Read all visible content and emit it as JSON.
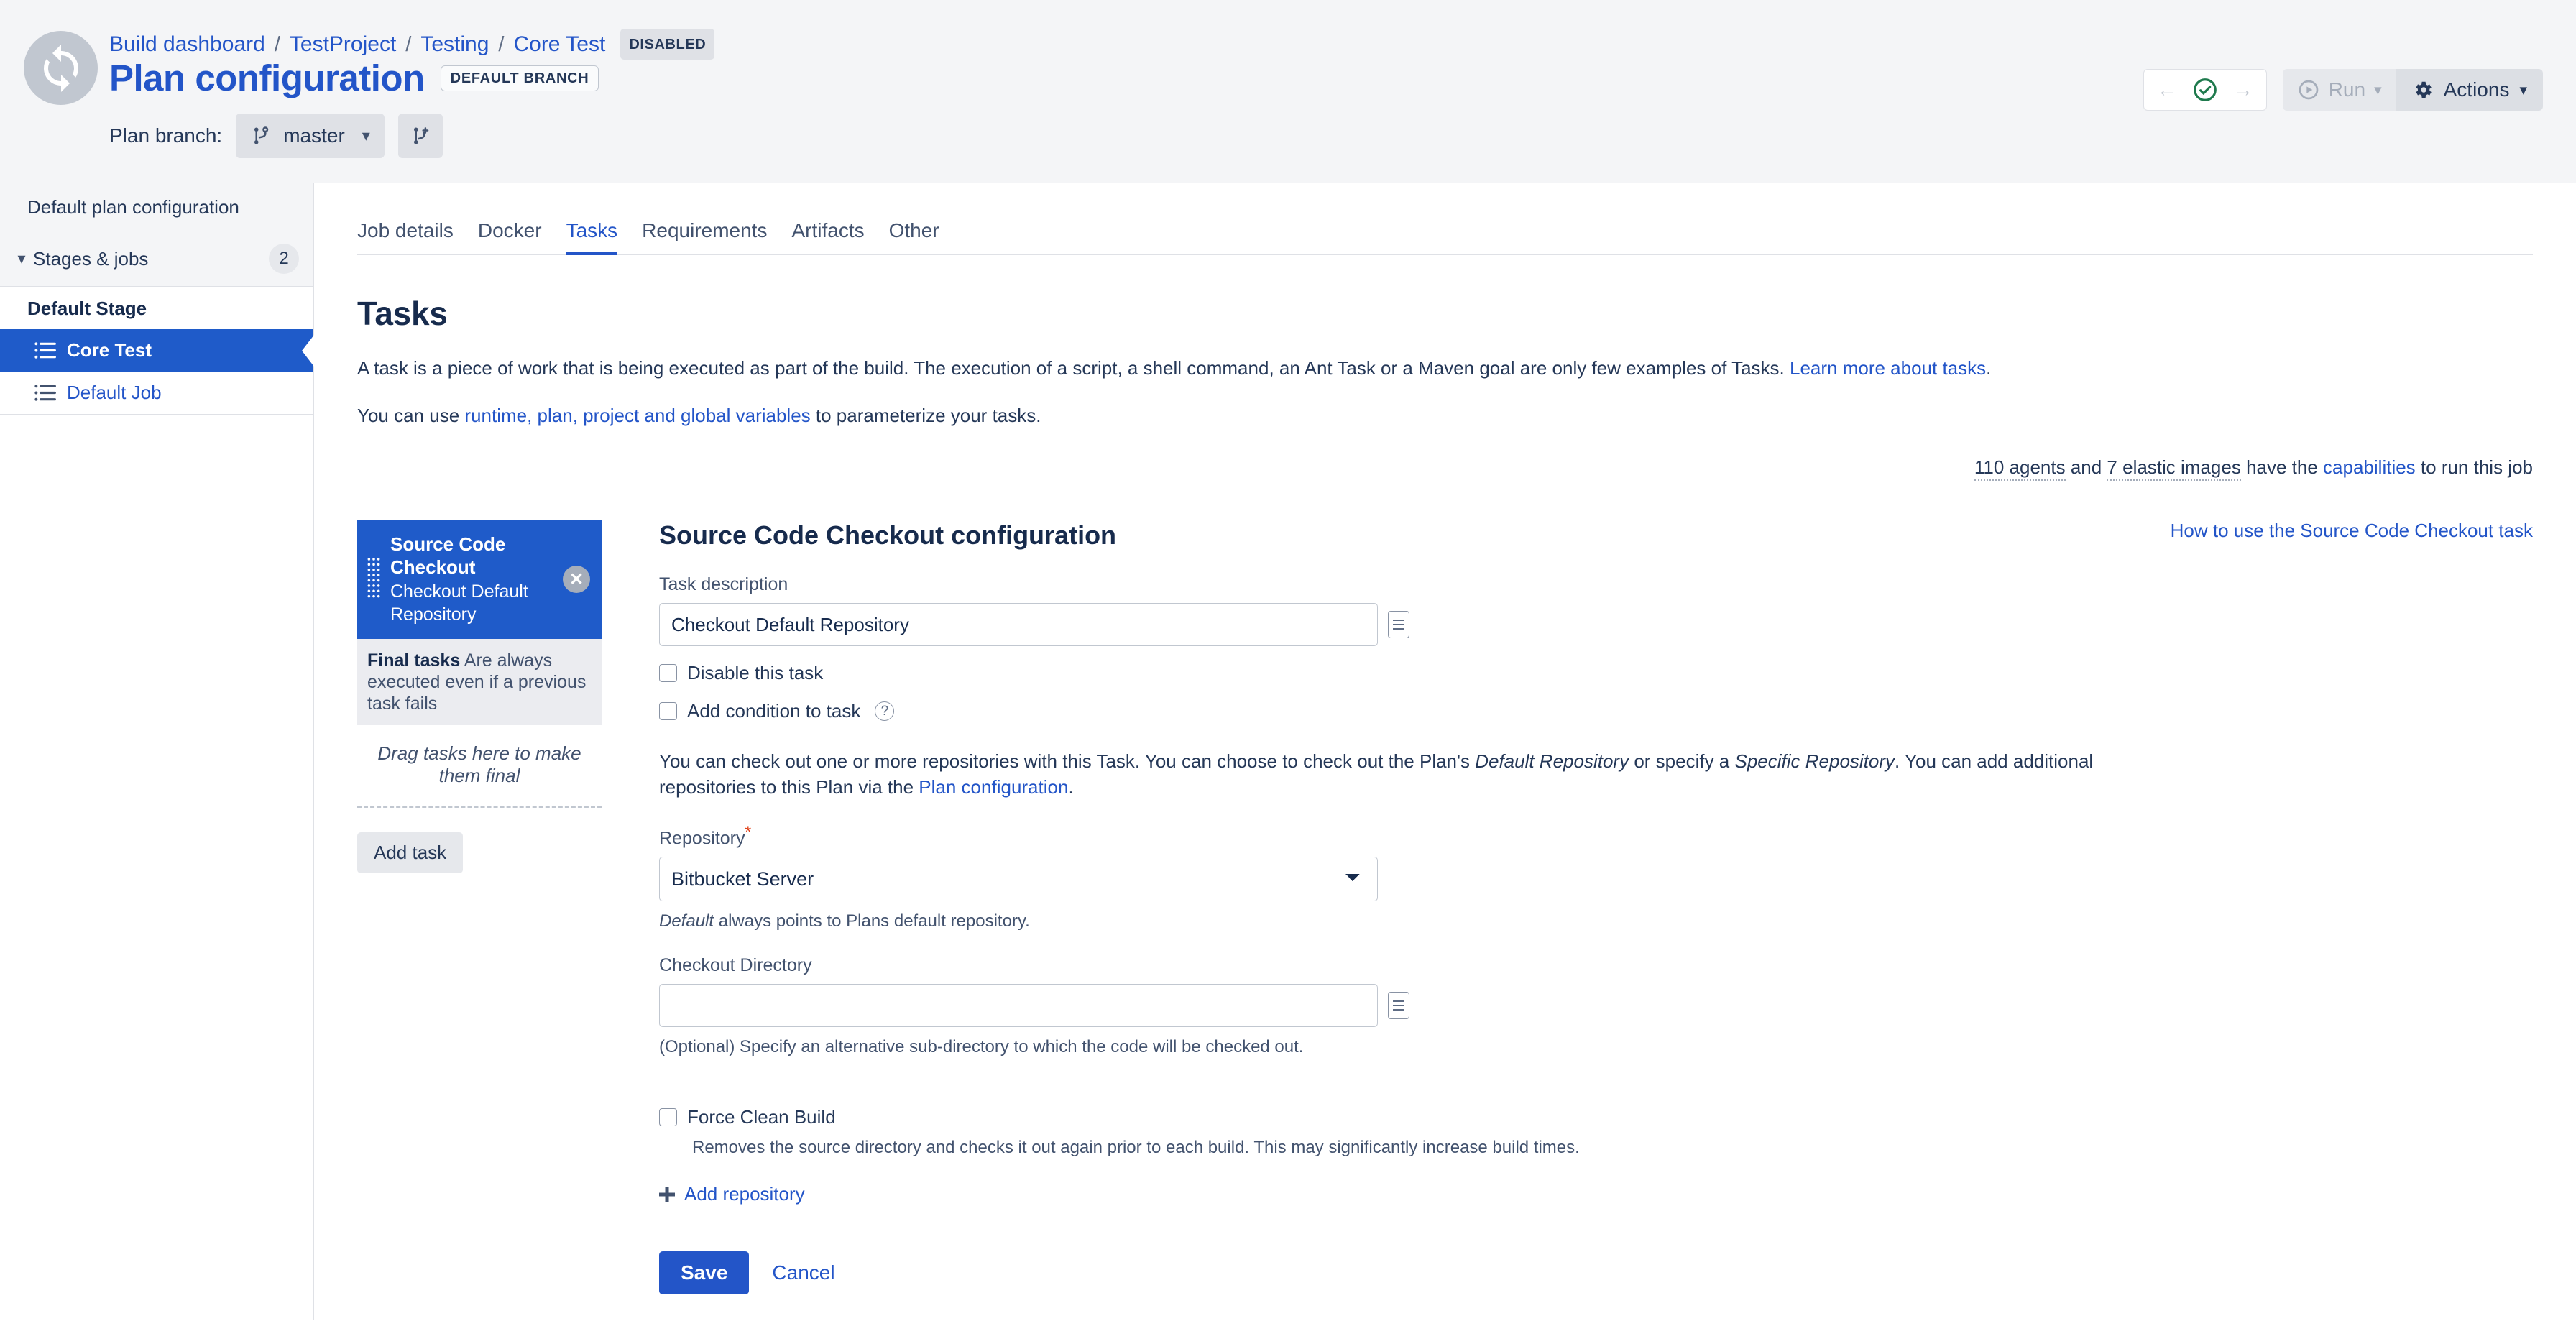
{
  "header": {
    "logo_icon": "sync-refresh-icon",
    "breadcrumb": [
      {
        "label": "Build dashboard"
      },
      {
        "label": "TestProject"
      },
      {
        "label": "Testing"
      },
      {
        "label": "Core Test"
      }
    ],
    "breadcrumb_separator": "/",
    "status_badge": "DISABLED",
    "page_title": "Plan configuration",
    "branch_badge": "DEFAULT BRANCH",
    "plan_branch_label": "Plan branch:",
    "branch_name": "master",
    "branch_add_icon": "branch-add-icon",
    "nav_back_icon": "arrow-left-icon",
    "nav_status_icon": "check-circle-icon",
    "nav_forward_icon": "arrow-right-icon",
    "run_label": "Run",
    "actions_label": "Actions",
    "run_icon": "play-circle-icon",
    "actions_icon": "gear-icon"
  },
  "sidebar": {
    "default_plan_config": "Default plan configuration",
    "stages_jobs_label": "Stages & jobs",
    "stages_jobs_count": "2",
    "stage_name": "Default Stage",
    "jobs": [
      {
        "label": "Core Test",
        "active": true
      },
      {
        "label": "Default Job",
        "active": false
      }
    ]
  },
  "tabs": [
    {
      "label": "Job details",
      "active": false
    },
    {
      "label": "Docker",
      "active": false
    },
    {
      "label": "Tasks",
      "active": true
    },
    {
      "label": "Requirements",
      "active": false
    },
    {
      "label": "Artifacts",
      "active": false
    },
    {
      "label": "Other",
      "active": false
    }
  ],
  "tasks_section": {
    "heading": "Tasks",
    "intro_part1": "A task is a piece of work that is being executed as part of the build. The execution of a script, a shell command, an Ant Task or a Maven goal are only few examples of Tasks. ",
    "intro_link": "Learn more about tasks",
    "intro_part2": ".",
    "variables_part1": "You can use ",
    "variables_link": "runtime, plan, project and global variables",
    "variables_part2": " to parameterize your tasks.",
    "agents_count": "110 agents",
    "agents_and": " and ",
    "elastic_images": "7 elastic images",
    "agents_have_the": " have the ",
    "capabilities_link": "capabilities",
    "agents_tail": " to run this job"
  },
  "task_list": {
    "task_title": "Source Code Checkout",
    "task_subtitle": "Checkout Default Repository",
    "close_icon": "close-icon",
    "drag_icon": "drag-handle-icon",
    "final_tasks_bold": "Final tasks",
    "final_tasks_text": " Are always executed even if a previous task fails",
    "drag_zone_text": "Drag tasks here to make them final",
    "add_task_label": "Add task"
  },
  "config": {
    "title": "Source Code Checkout configuration",
    "help_link": "How to use the Source Code Checkout task",
    "task_description_label": "Task description",
    "task_description_value": "Checkout Default Repository",
    "variable_picker_icon": "variable-picker-icon",
    "disable_task_label": "Disable this task",
    "disable_task_checked": false,
    "add_condition_label": "Add condition to task",
    "add_condition_checked": false,
    "help_icon": "question-mark-icon",
    "repo_para_1": "You can check out one or more repositories with this Task. You can choose to check out the Plan's ",
    "repo_para_em1": "Default Repository",
    "repo_para_2": " or specify a ",
    "repo_para_em2": "Specific Repository",
    "repo_para_3": ". You can add additional repositories to this Plan via the ",
    "repo_para_link": "Plan configuration",
    "repo_para_4": ".",
    "repository_label": "Repository",
    "repository_required": "*",
    "repository_value": "Bitbucket Server",
    "repository_options": [
      "Bitbucket Server"
    ],
    "repository_hint_em": "Default",
    "repository_hint": " always points to Plans default repository.",
    "checkout_dir_label": "Checkout Directory",
    "checkout_dir_value": "",
    "checkout_dir_placeholder": "",
    "checkout_dir_hint": "(Optional) Specify an alternative sub-directory to which the code will be checked out.",
    "force_clean_label": "Force Clean Build",
    "force_clean_checked": false,
    "force_clean_hint": "Removes the source directory and checks it out again prior to each build. This may significantly increase build times.",
    "add_repository_label": "Add repository",
    "add_repository_icon": "plus-icon",
    "save_label": "Save",
    "cancel_label": "Cancel"
  },
  "colors": {
    "accent_blue": "#2355c8",
    "selected_blue": "#1f5bc9",
    "header_bg": "#f4f5f7",
    "border": "#dfe1e6",
    "text": "#172b4d",
    "required_red": "#de350b",
    "success_green": "#1f7a4d"
  }
}
